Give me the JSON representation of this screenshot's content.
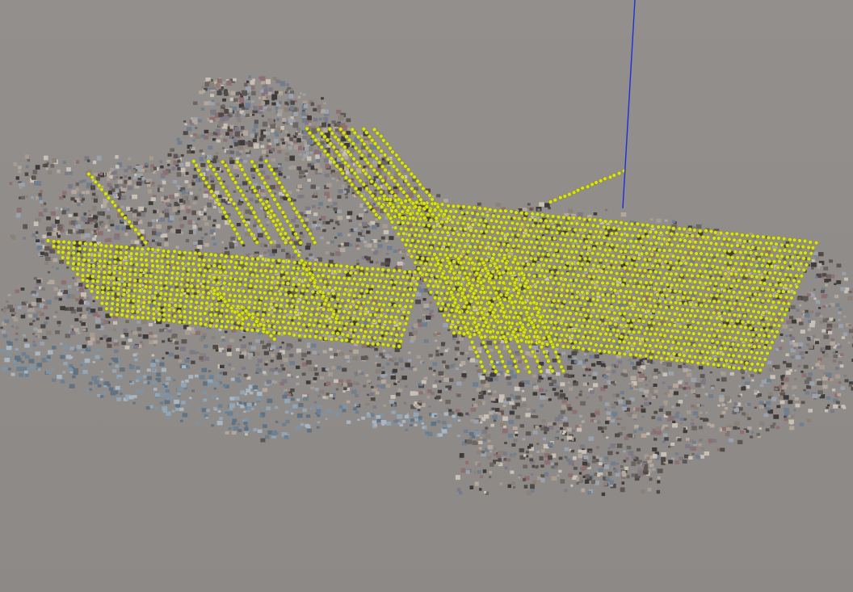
{
  "app": {
    "view": "3d-point-cloud-viewport",
    "background_color": "#8f8b89"
  },
  "scene": {
    "point_cloud": {
      "palette": [
        "#6b6662",
        "#8a8178",
        "#a79c8f",
        "#4f4a48",
        "#b4a79c",
        "#7d7a86",
        "#9aa3ad",
        "#c9c1b5",
        "#5e5652",
        "#8e6f72",
        "#6f7f8f",
        "#3f3b3a"
      ],
      "water_palette": [
        "#7f93a3",
        "#93a6b5",
        "#6c8091",
        "#a8b7c3",
        "#5f7383"
      ]
    },
    "camera_positions": {
      "marker_color": "#d8e21f",
      "marker_edge_color": "#8a8f10"
    },
    "axis": {
      "label": "z-axis",
      "color": "#1f2fd6"
    }
  }
}
